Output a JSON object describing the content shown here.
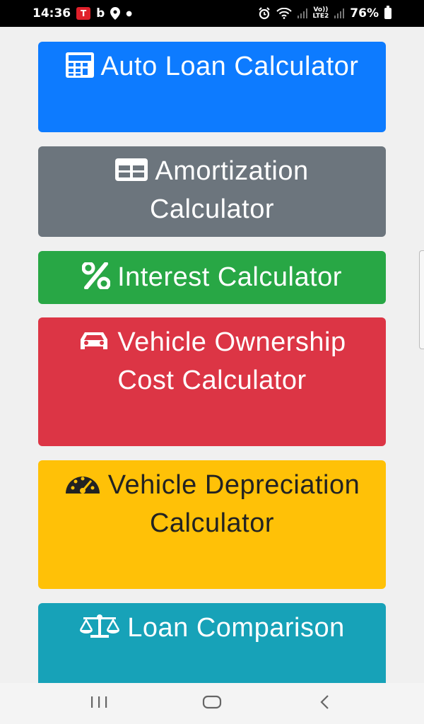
{
  "status_bar": {
    "time": "14:36",
    "battery": "76%",
    "carrier_badge": "T",
    "b_glyph": "b",
    "volte_top": "Vo))",
    "volte_bottom": "LTE2"
  },
  "buttons": [
    {
      "icon": "calculator-icon",
      "label": "Auto Loan Calculator",
      "color": "#0d7bff"
    },
    {
      "icon": "table-icon",
      "label": "Amortization Calculator",
      "color": "#6c757d"
    },
    {
      "icon": "percent-icon",
      "label": "Interest Calculator",
      "color": "#28a745"
    },
    {
      "icon": "car-icon",
      "label": "Vehicle Ownership Cost Calculator",
      "color": "#dc3545"
    },
    {
      "icon": "speedometer-icon",
      "label": "Vehicle Depreciation Calculator",
      "color": "#ffc107"
    },
    {
      "icon": "balance-scale-icon",
      "label": "Loan Comparison",
      "color": "#17a2b8"
    }
  ],
  "nav": {
    "recent_icon": "recent-apps-icon",
    "home_icon": "home-icon",
    "back_icon": "back-icon"
  }
}
